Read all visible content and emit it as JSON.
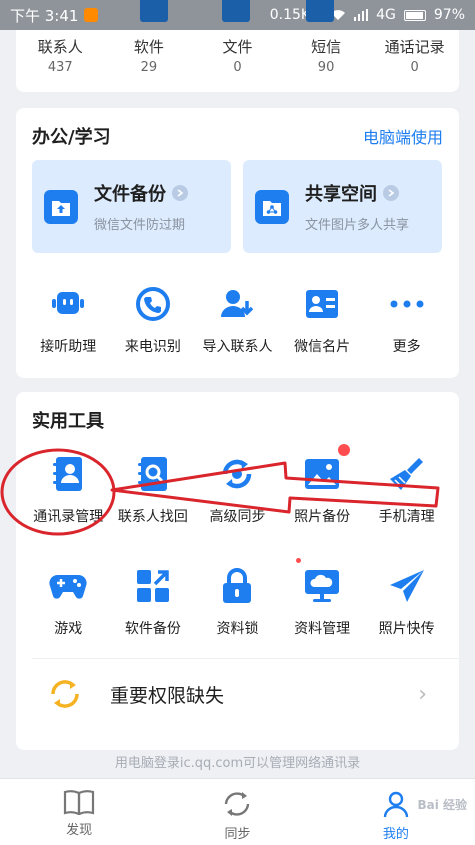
{
  "status_bar": {
    "time": "下午 3:41",
    "network": "0.15K/s",
    "signal": "4G",
    "battery": "97%"
  },
  "stats": [
    {
      "label": "联系人",
      "count": "437"
    },
    {
      "label": "软件",
      "count": "29"
    },
    {
      "label": "文件",
      "count": "0"
    },
    {
      "label": "短信",
      "count": "90"
    },
    {
      "label": "通话记录",
      "count": "0"
    }
  ],
  "office": {
    "title": "办公/学习",
    "link": "电脑端使用",
    "features": [
      {
        "title": "文件备份",
        "subtitle": "微信文件防过期",
        "icon": "folder-upload-icon"
      },
      {
        "title": "共享空间",
        "subtitle": "文件图片多人共享",
        "icon": "share-folder-icon"
      }
    ],
    "items": [
      {
        "label": "接听助理",
        "icon": "robot-icon"
      },
      {
        "label": "来电识别",
        "icon": "phone-id-icon"
      },
      {
        "label": "导入联系人",
        "icon": "import-contact-icon"
      },
      {
        "label": "微信名片",
        "icon": "business-card-icon"
      },
      {
        "label": "更多",
        "icon": "more-dots-icon"
      }
    ]
  },
  "tools": {
    "title": "实用工具",
    "row1": [
      {
        "label": "通讯录管理",
        "icon": "contacts-book-icon"
      },
      {
        "label": "联系人找回",
        "icon": "contact-search-icon"
      },
      {
        "label": "高级同步",
        "icon": "sync-icon"
      },
      {
        "label": "照片备份",
        "icon": "photo-icon"
      },
      {
        "label": "手机清理",
        "icon": "broom-icon"
      }
    ],
    "row2": [
      {
        "label": "游戏",
        "icon": "gamepad-icon"
      },
      {
        "label": "软件备份",
        "icon": "app-grid-icon"
      },
      {
        "label": "资料锁",
        "icon": "lock-icon"
      },
      {
        "label": "资料管理",
        "icon": "cloud-monitor-icon"
      },
      {
        "label": "照片快传",
        "icon": "paper-plane-icon"
      }
    ],
    "permission": "重要权限缺失"
  },
  "footer_hint": "用电脑登录ic.qq.com可以管理网络通讯录",
  "bottom_nav": [
    {
      "label": "发现",
      "icon": "book-icon",
      "active": false
    },
    {
      "label": "同步",
      "icon": "sync-nav-icon",
      "active": false
    },
    {
      "label": "我的",
      "icon": "profile-icon",
      "active": true
    }
  ],
  "watermark": "Bai 经验",
  "colors": {
    "accent": "#1e7ef0",
    "annotation": "#d9252b"
  }
}
